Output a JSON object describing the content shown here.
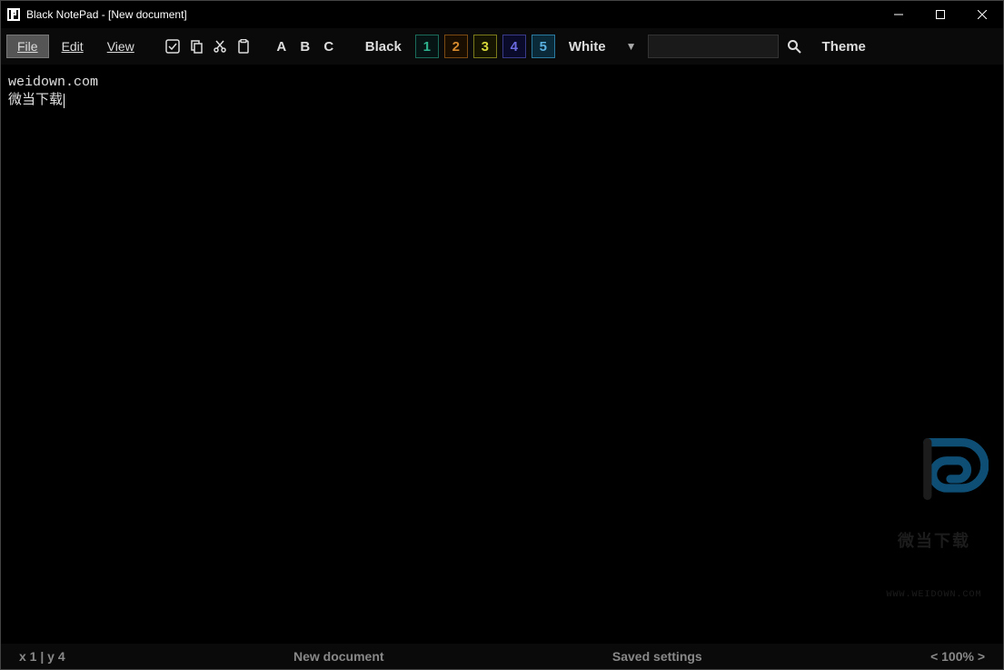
{
  "title": "Black NotePad - [New document]",
  "menus": {
    "file": "File",
    "edit": "Edit",
    "view": "View"
  },
  "letters": {
    "a": "A",
    "b": "B",
    "c": "C"
  },
  "scheme": {
    "black": "Black",
    "white": "White"
  },
  "swatches": [
    {
      "num": "1",
      "bg": "#061414",
      "border": "#1a6b5a",
      "color": "#2fb38f"
    },
    {
      "num": "2",
      "bg": "#1a0e00",
      "border": "#7a4a12",
      "color": "#d68a2e"
    },
    {
      "num": "3",
      "bg": "#141400",
      "border": "#7a7a1a",
      "color": "#d6d63a"
    },
    {
      "num": "4",
      "bg": "#0a0a2a",
      "border": "#3a3a8a",
      "color": "#6a6ae0"
    },
    {
      "num": "5",
      "bg": "#0a2a3a",
      "border": "#2a7aa0",
      "color": "#5ab0e0"
    }
  ],
  "theme_label": "Theme",
  "editor_text": "weidown.com\n微当下载",
  "status": {
    "pos": "x 1 | y 4",
    "doc": "New document",
    "msg": "Saved settings",
    "zoom": "< 100% >"
  },
  "watermark": {
    "cn": "微当下载",
    "url": "WWW.WEIDOWN.COM"
  }
}
